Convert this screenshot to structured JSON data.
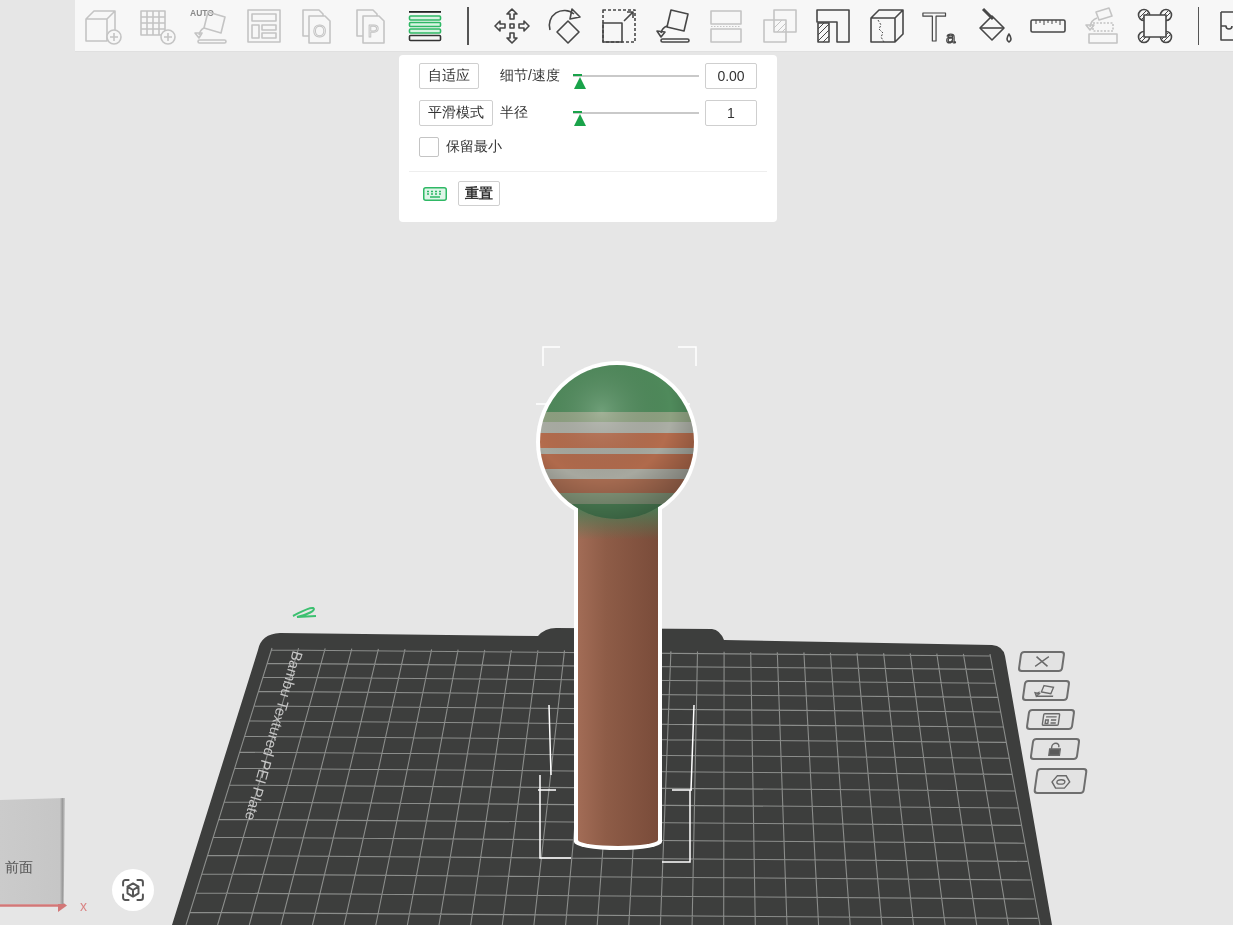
{
  "toolbar": {
    "items": [
      {
        "kind": "add-object",
        "disabled": true,
        "selected": false
      },
      {
        "kind": "add-plate",
        "disabled": true,
        "selected": false
      },
      {
        "kind": "auto-orient",
        "glyph": "AUTO",
        "disabled": true,
        "selected": false
      },
      {
        "kind": "arrange",
        "disabled": true,
        "selected": false
      },
      {
        "kind": "split-objects",
        "glyph": "O",
        "disabled": true,
        "selected": false
      },
      {
        "kind": "split-parts",
        "glyph": "P",
        "disabled": true,
        "selected": false
      },
      {
        "kind": "layer-height",
        "disabled": false,
        "selected": true
      },
      {
        "kind": "separator"
      },
      {
        "kind": "move",
        "disabled": false,
        "selected": false
      },
      {
        "kind": "rotate",
        "disabled": false,
        "selected": false
      },
      {
        "kind": "scale",
        "disabled": false,
        "selected": false
      },
      {
        "kind": "lay-on-face",
        "disabled": false,
        "selected": false
      },
      {
        "kind": "cut",
        "disabled": true,
        "selected": false
      },
      {
        "kind": "boolean",
        "disabled": true,
        "selected": false
      },
      {
        "kind": "support-paint",
        "disabled": false,
        "selected": false
      },
      {
        "kind": "seam-paint",
        "disabled": false,
        "selected": false
      },
      {
        "kind": "text",
        "glyph": "T",
        "subglyph": "a",
        "disabled": false,
        "selected": false
      },
      {
        "kind": "color-paint",
        "disabled": false,
        "selected": false
      },
      {
        "kind": "measure",
        "disabled": false,
        "selected": false
      },
      {
        "kind": "assembly",
        "disabled": true,
        "selected": false
      },
      {
        "kind": "brim-ears",
        "disabled": false,
        "selected": false
      },
      {
        "kind": "separator"
      },
      {
        "kind": "assembly-view",
        "disabled": false,
        "selected": false
      }
    ]
  },
  "layer_panel": {
    "rows": [
      {
        "kind": "slider",
        "button": "自适应",
        "label": "细节/速度",
        "level": 0,
        "value": "0.00"
      },
      {
        "kind": "slider",
        "button": "平滑模式",
        "label": "半径",
        "level": 0,
        "value": "1"
      },
      {
        "kind": "checkbox",
        "label": "保留最小",
        "checked": false
      }
    ],
    "reset_button": "重置"
  },
  "viewport": {
    "plate": {
      "label": "Bambu Textured PEI Plate"
    },
    "object": {
      "selected": true
    },
    "plate_buttons": [
      {
        "kind": "close"
      },
      {
        "kind": "orient"
      },
      {
        "kind": "arrange"
      },
      {
        "kind": "lock",
        "locked": false
      },
      {
        "kind": "settings"
      }
    ],
    "view_cube": {
      "face": "前面"
    },
    "axis": {
      "label": "x"
    }
  }
}
